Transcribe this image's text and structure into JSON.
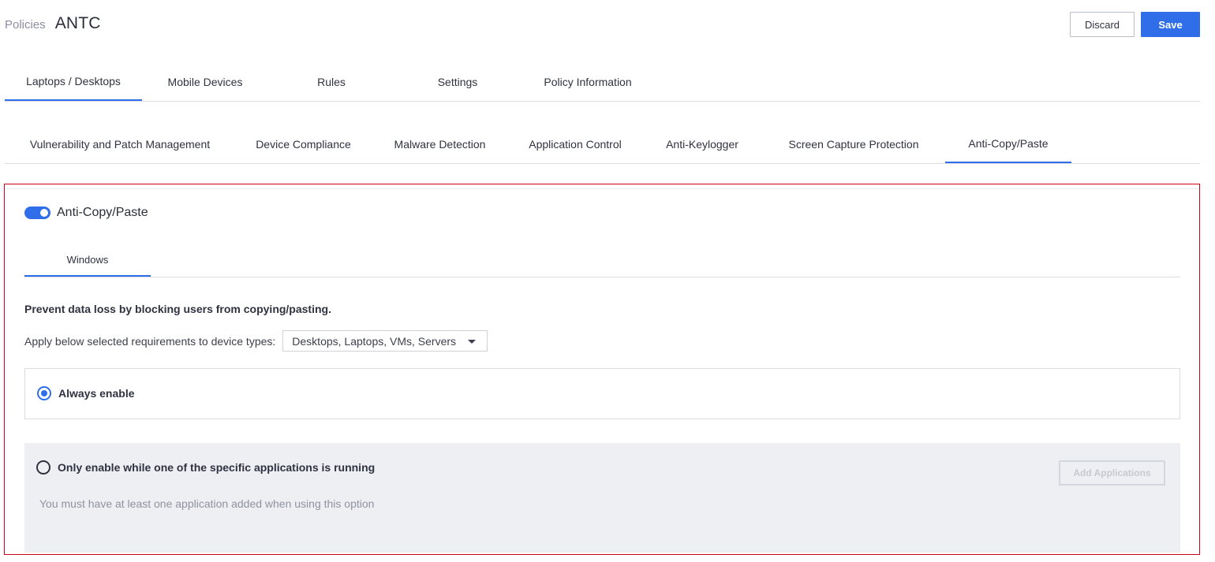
{
  "header": {
    "breadcrumb_link": "Policies",
    "title": "ANTC",
    "discard_label": "Discard",
    "save_label": "Save"
  },
  "main_tabs": [
    {
      "label": "Laptops / Desktops",
      "active": true
    },
    {
      "label": "Mobile Devices",
      "active": false
    },
    {
      "label": "Rules",
      "active": false
    },
    {
      "label": "Settings",
      "active": false
    },
    {
      "label": "Policy Information",
      "active": false
    }
  ],
  "sub_tabs": [
    {
      "label": "Vulnerability and Patch Management",
      "active": false
    },
    {
      "label": "Device Compliance",
      "active": false
    },
    {
      "label": "Malware Detection",
      "active": false
    },
    {
      "label": "Application Control",
      "active": false
    },
    {
      "label": "Anti-Keylogger",
      "active": false
    },
    {
      "label": "Screen Capture Protection",
      "active": false
    },
    {
      "label": "Anti-Copy/Paste",
      "active": true
    }
  ],
  "panel": {
    "toggle_label": "Anti-Copy/Paste",
    "toggle_on": true,
    "os_tab": "Windows",
    "description": "Prevent data loss by blocking users from copying/pasting.",
    "device_types_label": "Apply below selected requirements to device types:",
    "device_types_value": "Desktops, Laptops, VMs, Servers",
    "option_always": {
      "label": "Always enable",
      "selected": true
    },
    "option_specific": {
      "label": "Only enable while one of the specific applications is running",
      "selected": false,
      "hint": "You must have at least one application added when using this option",
      "add_button": "Add Applications",
      "add_button_disabled": true
    }
  },
  "colors": {
    "accent": "#2f6ee8",
    "highlight_border": "#d0021b",
    "disabled_panel_bg": "#eeeff2"
  }
}
